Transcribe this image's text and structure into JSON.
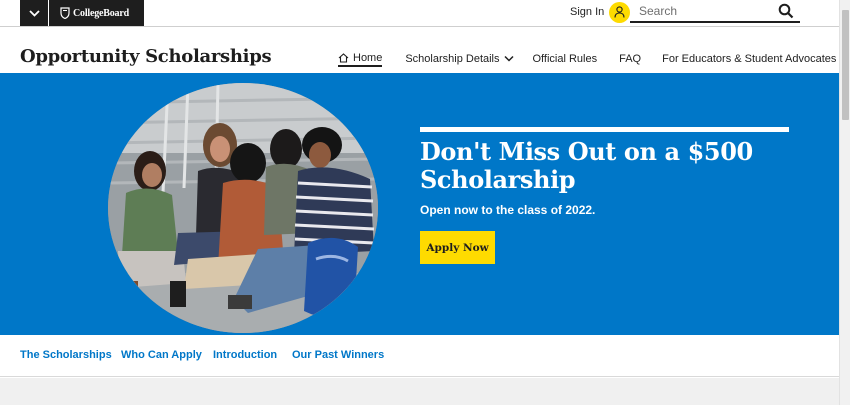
{
  "topbar": {
    "logo_text": "CollegeBoard",
    "sign_in_label": "Sign In",
    "search_placeholder": "Search",
    "icons": [
      "chevron-down-icon",
      "acorn-logo-icon",
      "user-icon",
      "search-icon"
    ]
  },
  "header": {
    "title": "Opportunity Scholarships",
    "nav": {
      "home": "Home",
      "details": "Scholarship Details",
      "rules": "Official Rules",
      "faq": "FAQ",
      "educators": "For Educators & Student Advocates"
    },
    "active_item": "Home"
  },
  "hero": {
    "heading": "Don't Miss Out on a $500 Scholarship",
    "subheading": "Open now to the class of 2022.",
    "cta_label": "Apply Now"
  },
  "local_nav": {
    "scholarships": "The Scholarships",
    "who": "Who Can Apply",
    "intro": "Introduction",
    "winners": "Our Past Winners"
  },
  "colors": {
    "brand_blue": "#0077c8",
    "brand_yellow": "#fedb00",
    "dark": "#1e1e1e",
    "link_blue": "#0077c8"
  }
}
